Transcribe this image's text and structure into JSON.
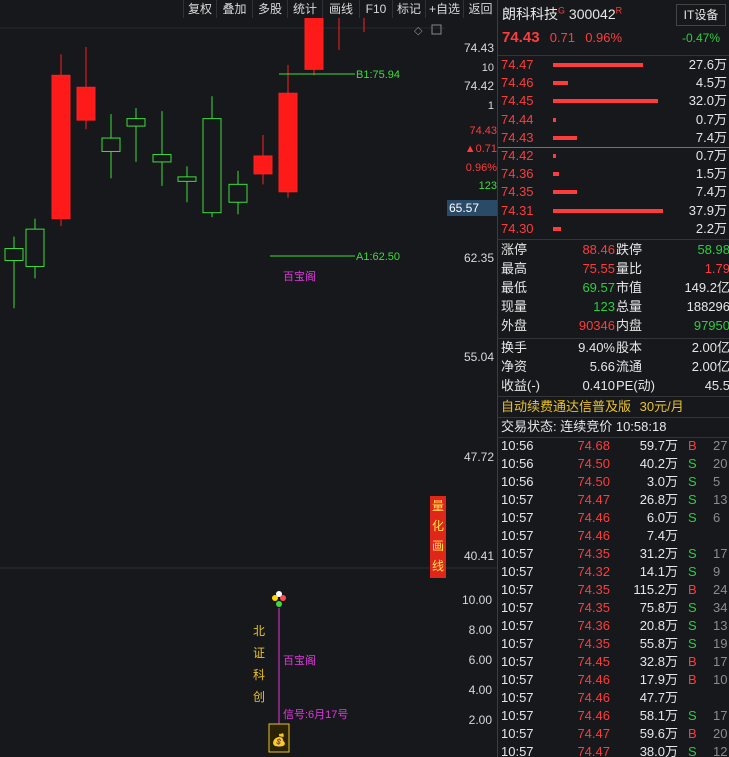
{
  "toolbar": {
    "items": [
      "复权",
      "叠加",
      "多股",
      "统计",
      "画线",
      "F10",
      "标记",
      "+自选",
      "返回"
    ]
  },
  "stock": {
    "name": "朗科科技",
    "superscript": "G",
    "code": "300042",
    "tag": "R",
    "price": "74.43",
    "change": "0.71",
    "pct": "0.96%",
    "sector": "IT设备",
    "sector_pct": "-0.47%"
  },
  "chart_data": {
    "type": "candlestick",
    "price_labels": [
      "74.43",
      "74.42",
      "62.35",
      "55.04",
      "47.72",
      "40.41"
    ],
    "right_misc": [
      "10",
      "1",
      "74.43",
      "▲0.71",
      "0.96%",
      "123",
      "65.57"
    ],
    "candles": [
      {
        "o": 61.0,
        "c": 60.2,
        "h": 61.8,
        "l": 57.0
      },
      {
        "o": 59.8,
        "c": 62.3,
        "h": 63.0,
        "l": 59.0
      },
      {
        "o": 72.6,
        "c": 63.0,
        "h": 74.0,
        "l": 62.5
      },
      {
        "o": 71.8,
        "c": 69.6,
        "h": 74.5,
        "l": 69.0
      },
      {
        "o": 67.5,
        "c": 68.4,
        "h": 70.0,
        "l": 65.7
      },
      {
        "o": 69.2,
        "c": 69.7,
        "h": 70.4,
        "l": 66.8
      },
      {
        "o": 66.8,
        "c": 67.3,
        "h": 70.2,
        "l": 65.2
      },
      {
        "o": 65.5,
        "c": 65.8,
        "h": 66.5,
        "l": 64.1
      },
      {
        "o": 63.4,
        "c": 69.7,
        "h": 71.2,
        "l": 63.1
      },
      {
        "o": 64.1,
        "c": 65.3,
        "h": 66.2,
        "l": 63.3
      },
      {
        "o": 67.2,
        "c": 66.0,
        "h": 68.6,
        "l": 65.3
      },
      {
        "o": 71.4,
        "c": 64.8,
        "h": 73.3,
        "l": 64.4
      },
      {
        "o": 73.0,
        "c": 77.0,
        "h": 79.8,
        "l": 72.6
      },
      {
        "o": 77.2,
        "c": 80.3,
        "h": 80.4,
        "l": 74.3
      },
      {
        "o": 79.0,
        "c": 80.4,
        "h": 81.3,
        "l": 75.5
      }
    ],
    "b1_label": "B1:75.94",
    "a1_label": "A1:62.50",
    "baobao": "百宝阁",
    "lower_axis": [
      "10.00",
      "8.00",
      "6.00",
      "4.00",
      "2.00"
    ],
    "lower_signal": "信号:6月17号",
    "lower_tag": "百宝阁",
    "vertical_text": "北证科创",
    "quant_badge": "量化画线"
  },
  "orderbook": [
    {
      "p": "74.47",
      "v": "27.6万",
      "w": 0.82
    },
    {
      "p": "74.46",
      "v": "4.5万",
      "w": 0.14
    },
    {
      "p": "74.45",
      "v": "32.0万",
      "w": 0.95
    },
    {
      "p": "74.44",
      "v": "0.7万",
      "w": 0.03
    },
    {
      "p": "74.43",
      "v": "7.4万",
      "w": 0.22
    },
    {
      "p": "74.42",
      "v": "0.7万",
      "w": 0.03
    },
    {
      "p": "74.36",
      "v": "1.5万",
      "w": 0.05
    },
    {
      "p": "74.35",
      "v": "7.4万",
      "w": 0.22
    },
    {
      "p": "74.31",
      "v": "37.9万",
      "w": 1.0
    },
    {
      "p": "74.30",
      "v": "2.2万",
      "w": 0.07
    }
  ],
  "stats": [
    {
      "l1": "涨停",
      "v1": "88.46",
      "c1": "red",
      "l2": "跌停",
      "v2": "58.98",
      "c2": "green"
    },
    {
      "l1": "最高",
      "v1": "75.55",
      "c1": "red",
      "l2": "量比",
      "v2": "1.79",
      "c2": "red"
    },
    {
      "l1": "最低",
      "v1": "69.57",
      "c1": "green",
      "l2": "市值",
      "v2": "149.2亿",
      "c2": "white"
    },
    {
      "l1": "现量",
      "v1": "123",
      "c1": "green",
      "l2": "总量",
      "v2": "188296",
      "c2": "white"
    },
    {
      "l1": "外盘",
      "v1": "90346",
      "c1": "red",
      "l2": "内盘",
      "v2": "97950",
      "c2": "green"
    }
  ],
  "stats2": [
    {
      "l1": "换手",
      "v1": "9.40%",
      "l2": "股本",
      "v2": "2.00亿"
    },
    {
      "l1": "净资",
      "v1": "5.66",
      "l2": "流通",
      "v2": "2.00亿"
    },
    {
      "l1": "收益(-)",
      "v1": "0.410",
      "l2": "PE(动)",
      "v2": "45.5"
    }
  ],
  "promo": {
    "text": "自动续费通达信普及版",
    "price": "30元/月"
  },
  "trade_status": "交易状态: 连续竞价 10:58:18",
  "ticks": [
    {
      "t": "10:56",
      "p": "74.68",
      "v": "59.7万",
      "s": "B",
      "n": "27"
    },
    {
      "t": "10:56",
      "p": "74.50",
      "v": "40.2万",
      "s": "S",
      "n": "20"
    },
    {
      "t": "10:56",
      "p": "74.50",
      "v": "3.0万",
      "s": "S",
      "n": "5"
    },
    {
      "t": "10:57",
      "p": "74.47",
      "v": "26.8万",
      "s": "S",
      "n": "13"
    },
    {
      "t": "10:57",
      "p": "74.46",
      "v": "6.0万",
      "s": "S",
      "n": "6"
    },
    {
      "t": "10:57",
      "p": "74.46",
      "v": "7.4万",
      "s": "",
      "n": ""
    },
    {
      "t": "10:57",
      "p": "74.35",
      "v": "31.2万",
      "s": "S",
      "n": "17"
    },
    {
      "t": "10:57",
      "p": "74.32",
      "v": "14.1万",
      "s": "S",
      "n": "9"
    },
    {
      "t": "10:57",
      "p": "74.35",
      "v": "115.2万",
      "s": "B",
      "n": "24"
    },
    {
      "t": "10:57",
      "p": "74.35",
      "v": "75.8万",
      "s": "S",
      "n": "34"
    },
    {
      "t": "10:57",
      "p": "74.36",
      "v": "20.8万",
      "s": "S",
      "n": "13"
    },
    {
      "t": "10:57",
      "p": "74.35",
      "v": "55.8万",
      "s": "S",
      "n": "19"
    },
    {
      "t": "10:57",
      "p": "74.45",
      "v": "32.8万",
      "s": "B",
      "n": "17"
    },
    {
      "t": "10:57",
      "p": "74.46",
      "v": "17.9万",
      "s": "B",
      "n": "10"
    },
    {
      "t": "10:57",
      "p": "74.46",
      "v": "47.7万",
      "s": "",
      "n": ""
    },
    {
      "t": "10:57",
      "p": "74.46",
      "v": "58.1万",
      "s": "S",
      "n": "17"
    },
    {
      "t": "10:57",
      "p": "74.47",
      "v": "59.6万",
      "s": "B",
      "n": "20"
    },
    {
      "t": "10:57",
      "p": "74.47",
      "v": "38.0万",
      "s": "S",
      "n": "12"
    }
  ]
}
